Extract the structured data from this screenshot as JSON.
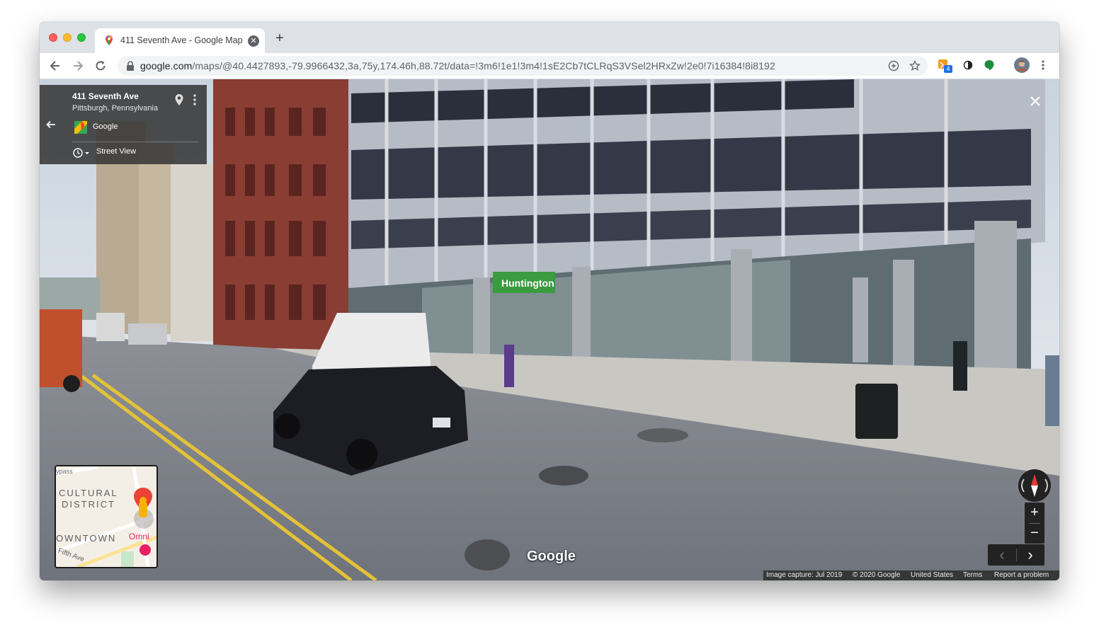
{
  "browser": {
    "tab_title": "411 Seventh Ave - Google Maps",
    "new_tab_symbol": "+",
    "url_host": "google.com",
    "url_path": "/maps/@40.4427893,-79.9966432,3a,75y,174.46h,88.72t/data=!3m6!1e1!3m4!1sE2Cb7tCLRqS3VSel2HRxZw!2e0!7i16384!8i8192",
    "extension_badge": "4",
    "icons": [
      "back-icon",
      "forward-icon",
      "reload-icon",
      "lock-icon",
      "add-icon",
      "star-icon",
      "extension-icon",
      "contrast-icon",
      "chat-icon",
      "avatar",
      "menu-icon"
    ]
  },
  "streetview": {
    "place_title": "411 Seventh Ave",
    "place_subtitle": "Pittsburgh, Pennsylvania",
    "source": "Google",
    "mode_label": "Street View",
    "sign_text": "Huntington",
    "watermark": "Google",
    "minimap": {
      "district": "CULTURAL",
      "district2": "DISTRICT",
      "area": "OWNTOWN",
      "poi": "Omni",
      "street": "Fifth Ave",
      "road": "ypass"
    },
    "zoom_in": "+",
    "zoom_out": "−",
    "prev": "‹",
    "next": "›",
    "footer": {
      "capture": "Image capture: Jul 2019",
      "copyright": "© 2020 Google",
      "country": "United States",
      "terms": "Terms",
      "report": "Report a problem"
    }
  },
  "colors": {
    "chrome_bg": "#dee1e6",
    "omnibox_bg": "#f1f3f4",
    "huntington_green": "#3a9b3f"
  }
}
